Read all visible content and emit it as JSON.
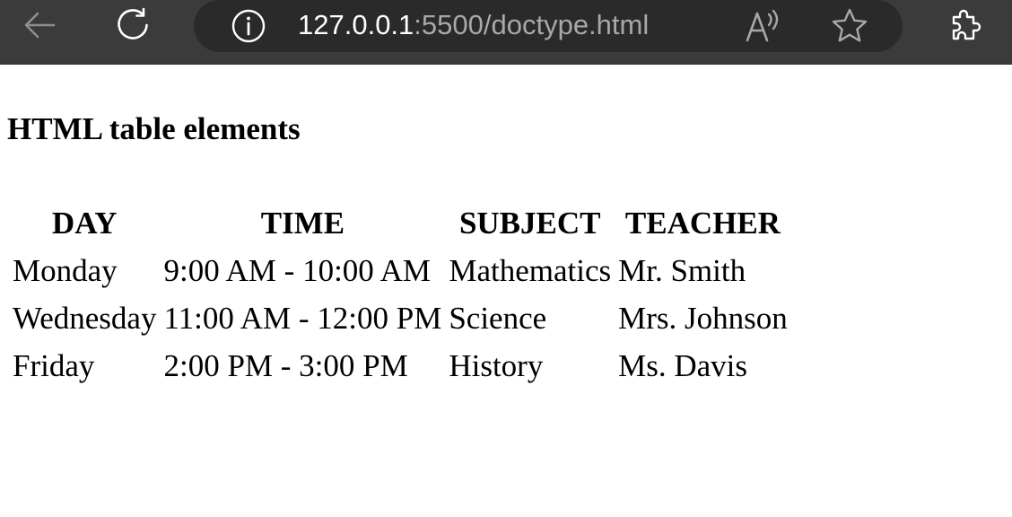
{
  "browser": {
    "url_host": "127.0.0.1",
    "url_path": ":5500/doctype.html",
    "icons": {
      "back": "back-arrow-icon",
      "reload": "reload-icon",
      "site_info": "info-icon",
      "read_aloud": "read-aloud-icon",
      "favorite": "star-icon",
      "extensions": "puzzle-icon"
    },
    "colors": {
      "toolbar": "#3b3b3b",
      "addressbar": "#2a2a2a",
      "url_host": "#ffffff",
      "url_path": "#a8a8a8"
    }
  },
  "page": {
    "heading": "HTML table elements",
    "table": {
      "headers": [
        "DAY",
        "TIME",
        "SUBJECT",
        "TEACHER"
      ],
      "rows": [
        [
          "Monday",
          "9:00 AM - 10:00 AM",
          "Mathematics",
          "Mr. Smith"
        ],
        [
          "Wednesday",
          "11:00 AM - 12:00 PM",
          "Science",
          "Mrs. Johnson"
        ],
        [
          "Friday",
          "2:00 PM - 3:00 PM",
          "History",
          "Ms. Davis"
        ]
      ]
    }
  }
}
